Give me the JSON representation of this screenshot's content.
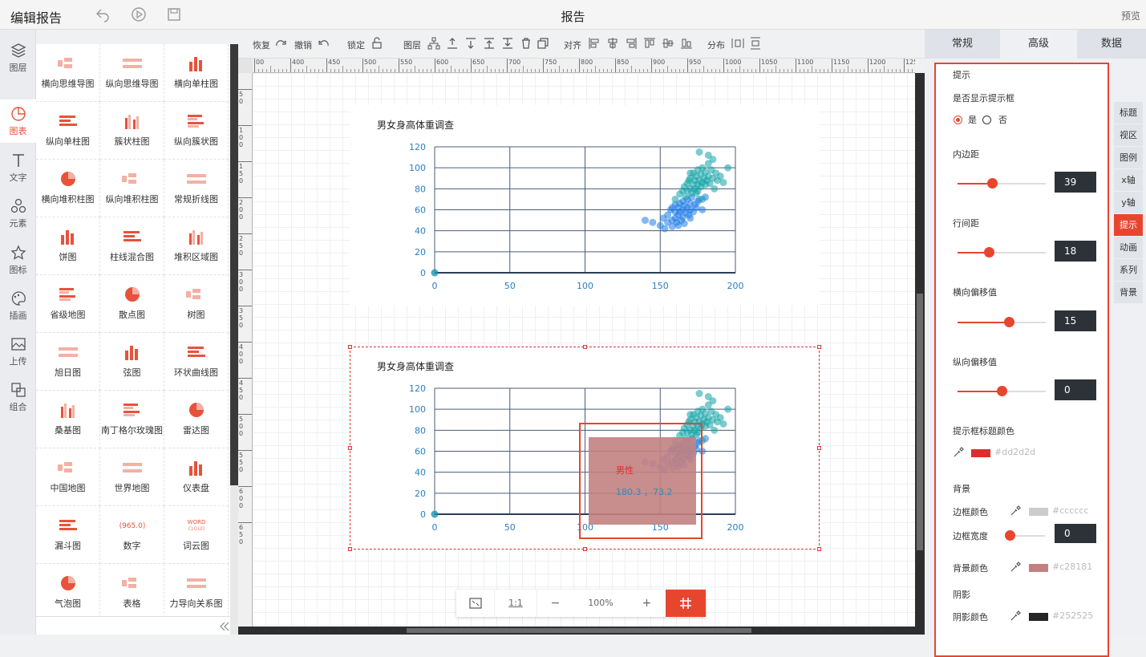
{
  "header": {
    "title": "编辑报告",
    "page_title": "报告",
    "preview": "预览"
  },
  "left_nav": [
    {
      "label": "图层",
      "icon": "layers-icon"
    },
    {
      "label": "图表",
      "icon": "chart-icon",
      "active": true
    },
    {
      "label": "文字",
      "icon": "text-icon"
    },
    {
      "label": "元素",
      "icon": "element-icon"
    },
    {
      "label": "图标",
      "icon": "star-icon"
    },
    {
      "label": "插画",
      "icon": "palette-icon"
    },
    {
      "label": "上传",
      "icon": "upload-image-icon"
    },
    {
      "label": "组合",
      "icon": "group-icon"
    }
  ],
  "chart_types": [
    "横向思维导图",
    "纵向思维导图",
    "横向单柱图",
    "纵向单柱图",
    "簇状柱图",
    "纵向簇状图",
    "横向堆积柱图",
    "纵向堆积柱图",
    "常规折线图",
    "饼图",
    "柱线混合图",
    "堆积区域图",
    "省级地图",
    "散点图",
    "树图",
    "旭日图",
    "弦图",
    "环状曲线图",
    "桑基图",
    "南丁格尔玫瑰图",
    "雷达图",
    "中国地图",
    "世界地图",
    "仪表盘",
    "漏斗图",
    "数字",
    "词云图",
    "气泡图",
    "表格",
    "力导向关系图"
  ],
  "number_icon_text": "965.0",
  "wordcloud_icon_text": [
    "WORD",
    "CLOUD"
  ],
  "toolbar": {
    "redo": "恢复",
    "undo": "撤销",
    "lock": "锁定",
    "layer": "图层",
    "align": "对齐",
    "distribute": "分布"
  },
  "ruler": {
    "top": [
      "00",
      "400",
      "450",
      "500",
      "550",
      "600",
      "650",
      "700",
      "750",
      "800",
      "850",
      "900",
      "950",
      "1000",
      "1050",
      "1100",
      "1150",
      "1200",
      "1250"
    ],
    "left": [
      "50",
      "100",
      "150",
      "200",
      "250",
      "300",
      "350",
      "400",
      "450",
      "500",
      "550",
      "600",
      "650"
    ]
  },
  "charts": [
    {
      "title": "男女身高体重调查"
    },
    {
      "title": "男女身高体重调查"
    }
  ],
  "tooltip": {
    "title": "男性",
    "value": "180.3 ，73.2"
  },
  "chart_data": [
    {
      "type": "scatter",
      "title": "男女身高体重调查",
      "xlabel": "",
      "ylabel": "",
      "xlim": [
        0,
        200
      ],
      "ylim": [
        0,
        120
      ],
      "xticks": [
        0,
        50,
        100,
        150,
        200
      ],
      "yticks": [
        0,
        20,
        40,
        60,
        80,
        100,
        120
      ],
      "series": [
        {
          "color": "#1e7be6",
          "points": [
            [
              140,
              50
            ],
            [
              145,
              48
            ],
            [
              150,
              45
            ],
            [
              152,
              52
            ],
            [
              155,
              55
            ],
            [
              155,
              48
            ],
            [
              157,
              60
            ],
            [
              158,
              62
            ],
            [
              158,
              50
            ],
            [
              160,
              58
            ],
            [
              160,
              65
            ],
            [
              160,
              52
            ],
            [
              161,
              48
            ],
            [
              162,
              55
            ],
            [
              162,
              62
            ],
            [
              163,
              58
            ],
            [
              163,
              66
            ],
            [
              164,
              50
            ],
            [
              165,
              60
            ],
            [
              165,
              68
            ],
            [
              165,
              53
            ],
            [
              166,
              64
            ],
            [
              167,
              57
            ],
            [
              168,
              62
            ],
            [
              168,
              70
            ],
            [
              169,
              55
            ],
            [
              170,
              66
            ],
            [
              170,
              60
            ],
            [
              171,
              72
            ],
            [
              172,
              58
            ],
            [
              173,
              65
            ],
            [
              174,
              62
            ],
            [
              175,
              68
            ],
            [
              176,
              70
            ],
            [
              178,
              60
            ],
            [
              180,
              72
            ],
            [
              162,
              45
            ],
            [
              158,
              44
            ],
            [
              166,
              47
            ],
            [
              170,
              52
            ],
            [
              153,
              42
            ],
            [
              0,
              0
            ]
          ]
        },
        {
          "color": "#11a3a6",
          "points": [
            [
              160,
              70
            ],
            [
              163,
              75
            ],
            [
              165,
              78
            ],
            [
              166,
              82
            ],
            [
              167,
              72
            ],
            [
              168,
              85
            ],
            [
              168,
              78
            ],
            [
              169,
              88
            ],
            [
              170,
              80
            ],
            [
              170,
              90
            ],
            [
              171,
              76
            ],
            [
              172,
              84
            ],
            [
              172,
              95
            ],
            [
              173,
              88
            ],
            [
              173,
              80
            ],
            [
              174,
              92
            ],
            [
              175,
              84
            ],
            [
              175,
              98
            ],
            [
              175,
              78
            ],
            [
              176,
              88
            ],
            [
              177,
              94
            ],
            [
              177,
              82
            ],
            [
              178,
              100
            ],
            [
              178,
              86
            ],
            [
              179,
              90
            ],
            [
              180,
              84
            ],
            [
              180,
              96
            ],
            [
              181,
              88
            ],
            [
              182,
              104
            ],
            [
              182,
              92
            ],
            [
              183,
              85
            ],
            [
              184,
              98
            ],
            [
              185,
              90
            ],
            [
              185,
              108
            ],
            [
              187,
              95
            ],
            [
              188,
              88
            ],
            [
              190,
              92
            ],
            [
              192,
              86
            ],
            [
              195,
              100
            ],
            [
              178,
              70
            ],
            [
              176,
              115
            ],
            [
              182,
              112
            ],
            [
              174,
              76
            ],
            [
              186,
              80
            ],
            [
              170,
              95
            ],
            [
              0,
              0
            ]
          ]
        }
      ]
    },
    {
      "type": "scatter",
      "title": "男女身高体重调查",
      "xlabel": "",
      "ylabel": "",
      "xlim": [
        0,
        200
      ],
      "ylim": [
        0,
        120
      ],
      "xticks": [
        0,
        50,
        100,
        150,
        200
      ],
      "yticks": [
        0,
        20,
        40,
        60,
        80,
        100,
        120
      ],
      "same_as": "first"
    }
  ],
  "zoom": {
    "fit_icon": "fit-screen-icon",
    "ratio": "1:1",
    "minus": "−",
    "value": "100%",
    "plus": "+",
    "grid_icon": "grid-icon"
  },
  "right_tabs": [
    {
      "label": "常规"
    },
    {
      "label": "高级",
      "active": true
    },
    {
      "label": "数据"
    }
  ],
  "props": {
    "section": "提示",
    "show_label": "是否显示提示框",
    "yes": "是",
    "no": "否",
    "padding": {
      "label": "内边距",
      "value": "39",
      "fraction": 0.39
    },
    "line_height": {
      "label": "行间距",
      "value": "18",
      "fraction": 0.35
    },
    "offset_x": {
      "label": "横向偏移值",
      "value": "15",
      "fraction": 0.58
    },
    "offset_y": {
      "label": "纵向偏移值",
      "value": "0",
      "fraction": 0.5
    },
    "title_color": {
      "label": "提示框标题颜色",
      "hex": "#dd2d2d",
      "color": "#dd2d2d"
    },
    "bg_section": "背景",
    "border_color": {
      "label": "边框颜色",
      "hex": "#cccccc",
      "color": "#cccccc"
    },
    "border_width": {
      "label": "边框宽度",
      "value": "0",
      "fraction": 0.0
    },
    "bg_color": {
      "label": "背景颜色",
      "hex": "#c28181",
      "color": "#c28181"
    },
    "shadow_section": "阴影",
    "shadow_color": {
      "label": "阴影颜色",
      "hex": "#252525",
      "color": "#252525"
    }
  },
  "side_tabs": [
    "标题",
    "视区",
    "图例",
    "x轴",
    "y轴",
    "提示",
    "动画",
    "系列",
    "背景"
  ],
  "side_tab_active": "提示"
}
